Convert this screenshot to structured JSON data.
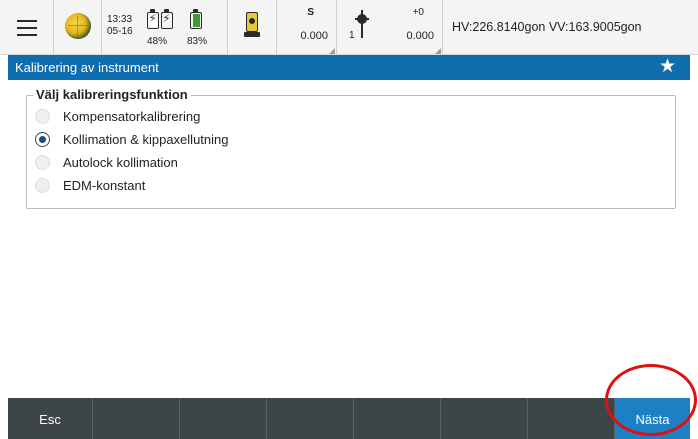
{
  "statusbar": {
    "menu_icon": "hamburger-menu-icon",
    "globe_icon": "globe-icon",
    "time": "13:33",
    "date": "05-16",
    "battery1_percent": "48%",
    "battery2_percent": "83%",
    "instrument_icon": "total-station-icon",
    "face_label": "S",
    "face_value": "0.000",
    "prism_icon": "prism-pole-icon",
    "prism_number": "1",
    "offset_label": "+0",
    "offset_value": "0.000",
    "angles": "HV:226.8140gon  VV:163.9005gon"
  },
  "titlebar": {
    "title": "Kalibrering av instrument",
    "star_icon": "favorite-star-icon"
  },
  "group": {
    "legend": "Välj kalibreringsfunktion",
    "options": [
      {
        "label": "Kompensatorkalibrering",
        "checked": false
      },
      {
        "label": "Kollimation & kippaxellutning",
        "checked": true
      },
      {
        "label": "Autolock kollimation",
        "checked": false
      },
      {
        "label": "EDM-konstant",
        "checked": false
      }
    ]
  },
  "softkeys": {
    "esc": "Esc",
    "next": "Nästa"
  },
  "colors": {
    "accent": "#0f6cad",
    "softkey_bar": "#3e4549",
    "next_button": "#1d7fc4",
    "highlight": "#e01010"
  }
}
